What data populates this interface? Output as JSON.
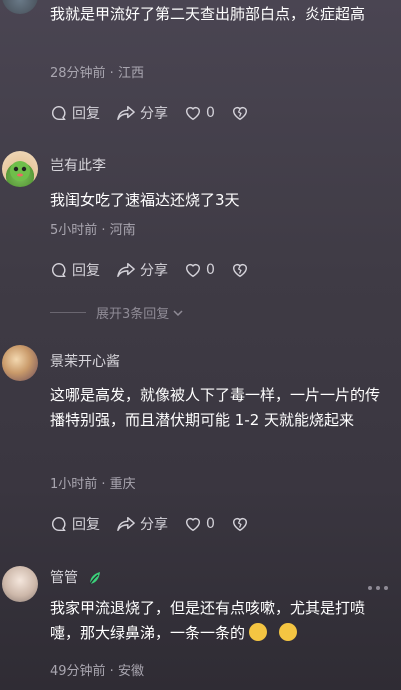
{
  "comments": [
    {
      "text": "我就是甲流好了第二天查出肺部白点，炎症超高",
      "meta": "28分钟前 · 江西",
      "reply_label": "回复",
      "share_label": "分享",
      "likes": "0"
    },
    {
      "name": "岂有此李",
      "text": "我闺女吃了速福达还烧了3天",
      "meta": "5小时前 · 河南",
      "reply_label": "回复",
      "share_label": "分享",
      "likes": "0"
    },
    {
      "name": "景茉开心酱",
      "text": "这哪是高发，就像被人下了毒一样，一片一片的传播特别强，而且潜伏期可能 1-2 天就能烧起来",
      "meta": "1小时前 · 重庆",
      "reply_label": "回复",
      "share_label": "分享",
      "likes": "0"
    },
    {
      "name": "管管",
      "text": "我家甲流退烧了，但是还有点咳嗽，尤其是打喷嚏，那大绿鼻涕，一条一条的",
      "meta": "49分钟前 · 安徽"
    }
  ],
  "expand_replies": "展开3条回复",
  "colors": {
    "accent": "#3bd17a",
    "emoji": "#f4c542"
  }
}
